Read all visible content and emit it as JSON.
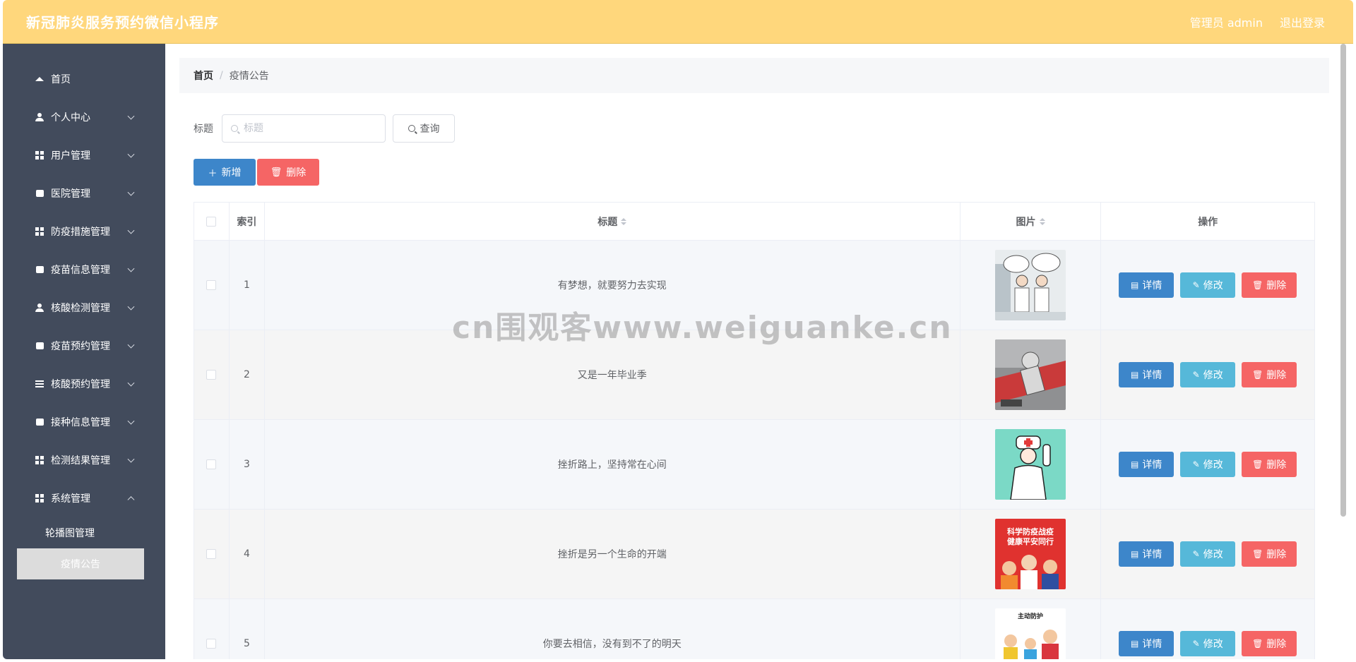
{
  "header": {
    "title": "新冠肺炎服务预约微信小程序",
    "user_label": "管理员 admin",
    "logout_label": "退出登录"
  },
  "sidebar": {
    "items": [
      {
        "label": "首页",
        "icon": "home-icon"
      },
      {
        "label": "个人中心",
        "icon": "user-icon"
      },
      {
        "label": "用户管理",
        "icon": "grid-icon"
      },
      {
        "label": "医院管理",
        "icon": "box-icon"
      },
      {
        "label": "防疫措施管理",
        "icon": "grid-icon"
      },
      {
        "label": "疫苗信息管理",
        "icon": "chart-icon"
      },
      {
        "label": "核酸检测管理",
        "icon": "person-icon"
      },
      {
        "label": "疫苗预约管理",
        "icon": "clipboard-icon"
      },
      {
        "label": "核酸预约管理",
        "icon": "list-icon"
      },
      {
        "label": "接种信息管理",
        "icon": "briefcase-icon"
      },
      {
        "label": "检测结果管理",
        "icon": "grid-icon"
      },
      {
        "label": "系统管理",
        "icon": "grid-icon"
      }
    ],
    "sub_items": [
      {
        "label": "轮播图管理"
      },
      {
        "label": "疫情公告"
      }
    ]
  },
  "breadcrumb": {
    "home": "首页",
    "separator": "/",
    "current": "疫情公告"
  },
  "search": {
    "label": "标题",
    "placeholder": "标题",
    "value": "",
    "query_label": "查询"
  },
  "actions": {
    "add_label": "新增",
    "delete_label": "删除"
  },
  "table": {
    "headers": {
      "index": "索引",
      "title": "标题",
      "image": "图片",
      "operation": "操作"
    },
    "rows": [
      {
        "index": "1",
        "title": "有梦想，就要努力去实现"
      },
      {
        "index": "2",
        "title": "又是一年毕业季"
      },
      {
        "index": "3",
        "title": "挫折路上，坚持常在心间"
      },
      {
        "index": "4",
        "title": "挫折是另一个生命的开端"
      },
      {
        "index": "5",
        "title": "你要去相信，没有到不了的明天"
      }
    ],
    "op_labels": {
      "detail": "详情",
      "edit": "修改",
      "delete": "删除"
    },
    "thumb_text": {
      "row4_line1": "科学防疫战疫",
      "row4_line2": "健康平安同行",
      "row5_top": "主动防护"
    }
  },
  "watermark": "cn围观客www.weiguanke.cn",
  "colors": {
    "header_bg": "#ffd77c",
    "sidebar_bg": "#424b5c",
    "primary": "#3d86ca",
    "info": "#56b8d9",
    "danger": "#f56565"
  }
}
